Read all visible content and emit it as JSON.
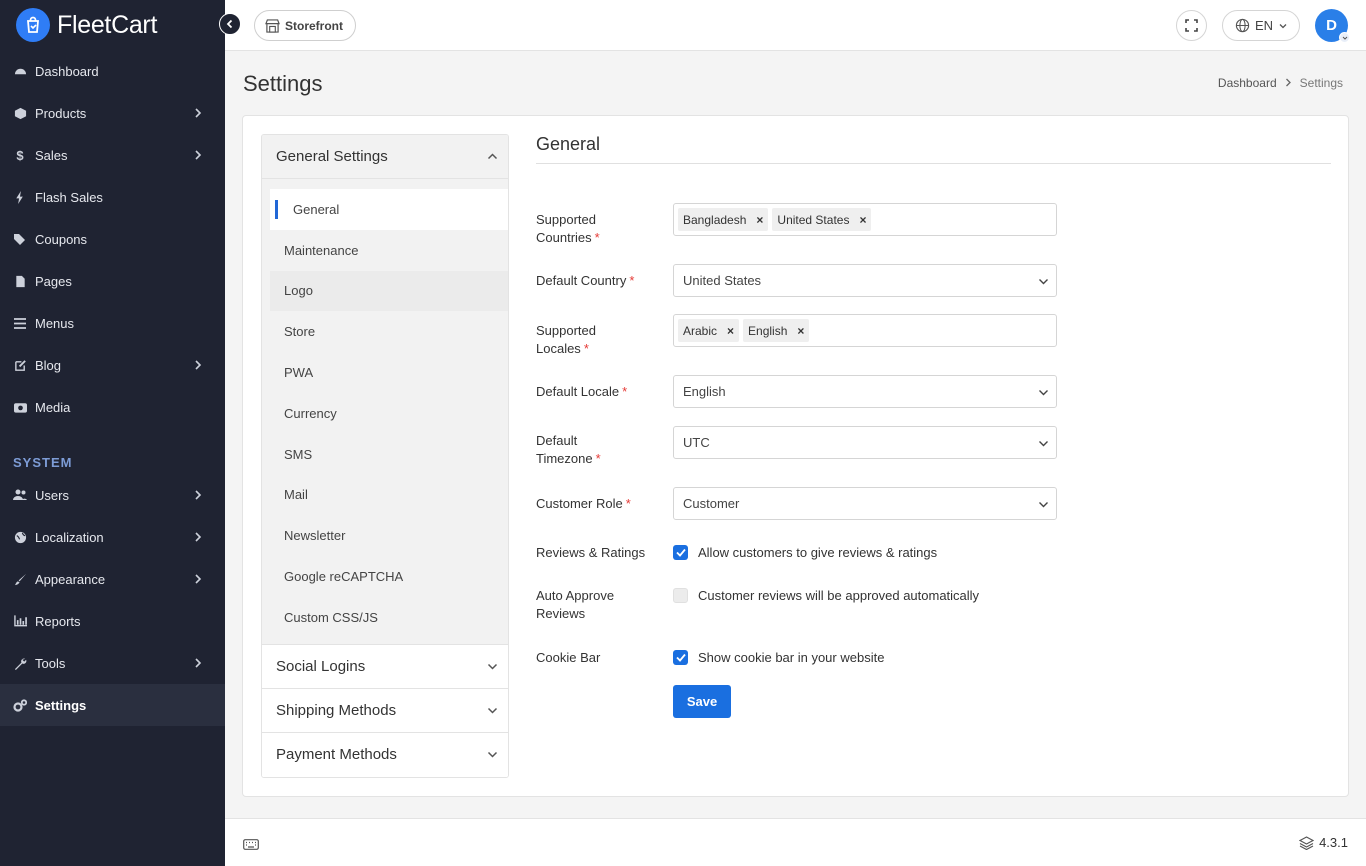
{
  "brand": {
    "name": "FleetCart",
    "accent": "#2f7df6"
  },
  "sidebar": {
    "items": [
      {
        "label": "Dashboard",
        "icon": "dashboard-icon"
      },
      {
        "label": "Products",
        "icon": "cube-icon",
        "expandable": true
      },
      {
        "label": "Sales",
        "icon": "dollar-icon",
        "expandable": true
      },
      {
        "label": "Flash Sales",
        "icon": "bolt-icon"
      },
      {
        "label": "Coupons",
        "icon": "tags-icon"
      },
      {
        "label": "Pages",
        "icon": "file-icon"
      },
      {
        "label": "Menus",
        "icon": "bars-icon"
      },
      {
        "label": "Blog",
        "icon": "edit-icon",
        "expandable": true
      },
      {
        "label": "Media",
        "icon": "camera-icon"
      }
    ],
    "section_label": "SYSTEM",
    "system_items": [
      {
        "label": "Users",
        "icon": "users-icon",
        "expandable": true
      },
      {
        "label": "Localization",
        "icon": "globe-icon",
        "expandable": true
      },
      {
        "label": "Appearance",
        "icon": "brush-icon",
        "expandable": true
      },
      {
        "label": "Reports",
        "icon": "chart-icon"
      },
      {
        "label": "Tools",
        "icon": "wrench-icon",
        "expandable": true
      },
      {
        "label": "Settings",
        "icon": "cogs-icon",
        "active": true
      }
    ]
  },
  "topbar": {
    "storefront_label": "Storefront",
    "language": "EN",
    "avatar_initial": "D"
  },
  "page": {
    "title": "Settings",
    "breadcrumb": {
      "home": "Dashboard",
      "current": "Settings"
    }
  },
  "settings_nav": {
    "groups": [
      {
        "label": "General Settings",
        "open": true
      },
      {
        "label": "Social Logins"
      },
      {
        "label": "Shipping Methods"
      },
      {
        "label": "Payment Methods"
      }
    ],
    "items": [
      {
        "label": "General",
        "active": true
      },
      {
        "label": "Maintenance"
      },
      {
        "label": "Logo"
      },
      {
        "label": "Store"
      },
      {
        "label": "PWA"
      },
      {
        "label": "Currency"
      },
      {
        "label": "SMS"
      },
      {
        "label": "Mail"
      },
      {
        "label": "Newsletter"
      },
      {
        "label": "Google reCAPTCHA"
      },
      {
        "label": "Custom CSS/JS"
      }
    ]
  },
  "form": {
    "title": "General",
    "supported_countries": {
      "label_1": "Supported",
      "label_2": "Countries",
      "tags": [
        "Bangladesh",
        "United States"
      ]
    },
    "default_country": {
      "label": "Default Country",
      "value": "United States"
    },
    "supported_locales": {
      "label_1": "Supported",
      "label_2": "Locales",
      "tags": [
        "Arabic",
        "English"
      ]
    },
    "default_locale": {
      "label": "Default Locale",
      "value": "English"
    },
    "default_timezone": {
      "label_1": "Default",
      "label_2": "Timezone",
      "value": "UTC"
    },
    "customer_role": {
      "label": "Customer Role",
      "value": "Customer"
    },
    "reviews": {
      "label": "Reviews & Ratings",
      "text": "Allow customers to give reviews & ratings",
      "checked": true
    },
    "auto_approve": {
      "label_1": "Auto Approve",
      "label_2": "Reviews",
      "text": "Customer reviews will be approved automatically",
      "checked": false
    },
    "cookie_bar": {
      "label": "Cookie Bar",
      "text": "Show cookie bar in your website",
      "checked": true
    },
    "save_label": "Save",
    "required_mark": "*"
  },
  "footer": {
    "version": "4.3.1"
  },
  "colors": {
    "sidebar_bg": "#1f2332",
    "primary": "#1a6fe0",
    "required": "#e53935"
  }
}
